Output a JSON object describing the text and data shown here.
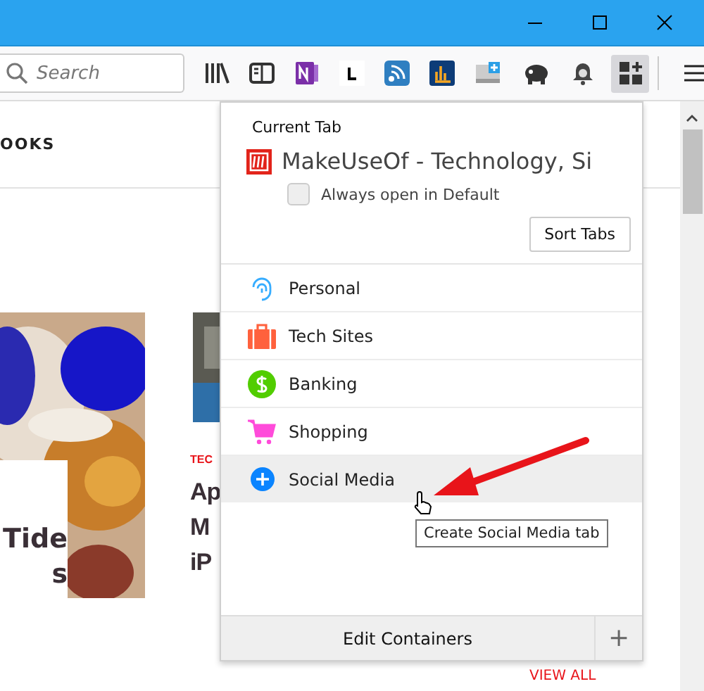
{
  "toolbar": {
    "search": {
      "placeholder": "Search"
    }
  },
  "page": {
    "nav_text": "OOKS",
    "articles": [
      {
        "title_lines": [
          "Tide",
          "s"
        ]
      },
      {
        "category": "TEC",
        "title_lines": [
          "Ap",
          "M",
          "iP"
        ]
      }
    ],
    "view_all": "VIEW ALL"
  },
  "panel": {
    "heading": "Current Tab",
    "tab_title": "MakeUseOf - Technology, Si",
    "always_open": {
      "label": "Always open in Default",
      "checked": false
    },
    "sort_button": "Sort Tabs",
    "containers": [
      {
        "name": "Personal",
        "kind": "fingerprint",
        "color": "#37adff",
        "hovered": false
      },
      {
        "name": "Tech Sites",
        "kind": "briefcase",
        "color": "#ff613d",
        "hovered": false
      },
      {
        "name": "Banking",
        "kind": "dollar",
        "color": "#51cd00",
        "hovered": false
      },
      {
        "name": "Shopping",
        "kind": "cart",
        "color": "#ff4bda",
        "hovered": false
      },
      {
        "name": "Social Media",
        "kind": "plus",
        "color": "#0a84ff",
        "hovered": true
      }
    ],
    "footer_button": "Edit Containers",
    "add_button": "+"
  },
  "tooltip": "Create Social Media tab"
}
